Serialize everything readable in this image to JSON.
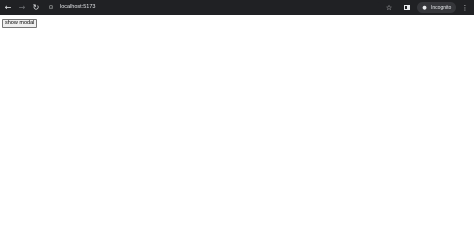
{
  "browser": {
    "url": "localhost:5173",
    "incognito_label": "Incognito",
    "icons": {
      "back": "arrow-left-icon",
      "forward": "arrow-right-icon",
      "reload": "reload-icon",
      "site_info": "site-info-icon",
      "bookmark": "star-icon",
      "side_panel": "side-panel-icon",
      "incognito": "incognito-icon",
      "menu": "more-vert-icon"
    },
    "colors": {
      "toolbar_bg": "#202124",
      "toolbar_fg": "#e8eaed"
    }
  },
  "page": {
    "show_modal_label": "show modal"
  }
}
